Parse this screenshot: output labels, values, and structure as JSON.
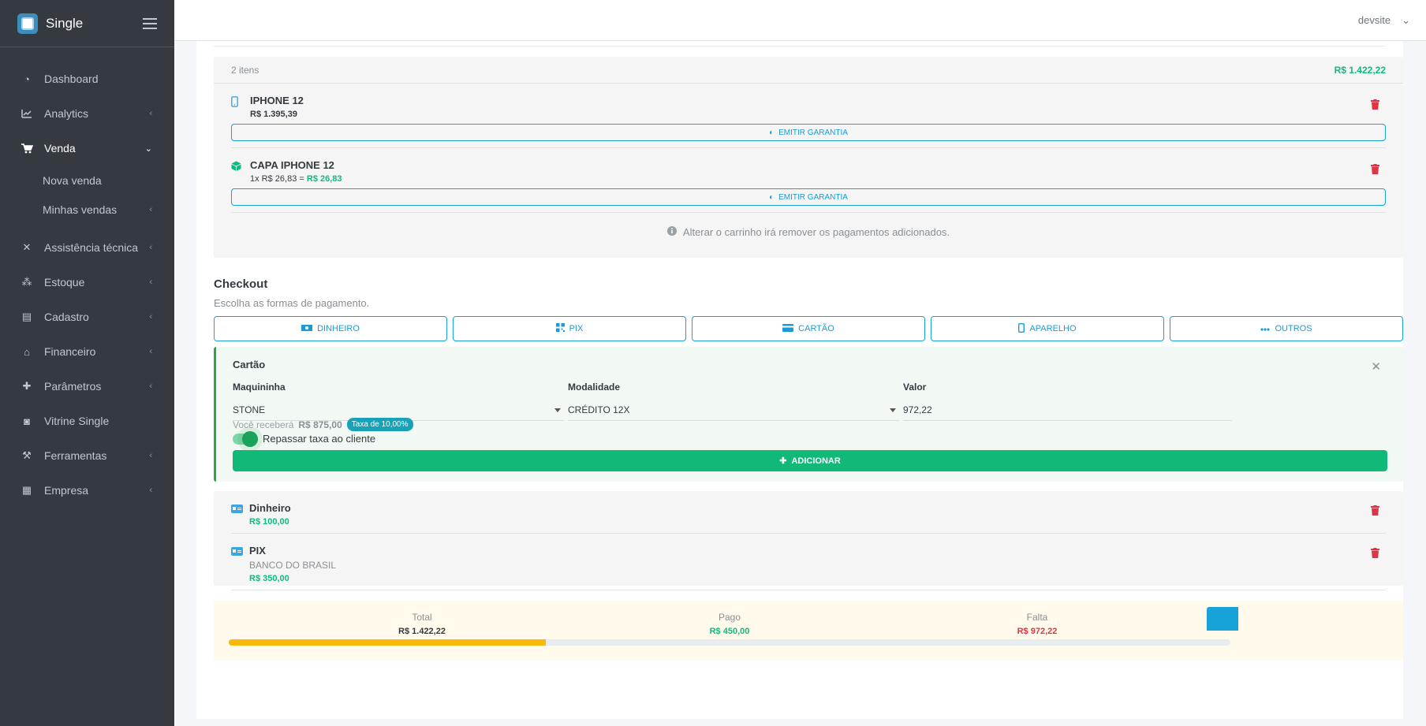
{
  "brand": {
    "name": "Single"
  },
  "sidebar": {
    "items": [
      {
        "label": "Dashboard",
        "icon": "pie-chart-icon"
      },
      {
        "label": "Analytics",
        "icon": "line-chart-icon"
      },
      {
        "label": "Venda",
        "icon": "shopping-cart-icon",
        "active": true
      },
      {
        "label": "Nova venda"
      },
      {
        "label": "Minhas vendas"
      },
      {
        "label": "Assistência técnica",
        "icon": "tools-icon"
      },
      {
        "label": "Estoque",
        "icon": "boxes-icon"
      },
      {
        "label": "Cadastro",
        "icon": "id-card-icon"
      },
      {
        "label": "Financeiro",
        "icon": "bank-icon"
      },
      {
        "label": "Parâmetros",
        "icon": "puzzle-icon"
      },
      {
        "label": "Vitrine Single",
        "icon": "shopping-bag-icon"
      },
      {
        "label": "Ferramentas",
        "icon": "wrench-icon"
      },
      {
        "label": "Empresa",
        "icon": "building-icon"
      }
    ]
  },
  "topbar": {
    "user": "devsite"
  },
  "cart": {
    "count_label": "2 itens",
    "total": "R$ 1.422,22",
    "items": [
      {
        "title": "IPHONE 12",
        "price": "R$ 1.395,39",
        "guarantee_label": "EMITIR GARANTIA"
      },
      {
        "title": "CAPA IPHONE 12",
        "qty_label": "1x R$ 26,83 =",
        "price": "R$ 26,83",
        "guarantee_label": "EMITIR GARANTIA"
      }
    ],
    "note": "Alterar o carrinho irá remover os pagamentos adicionados."
  },
  "checkout": {
    "title": "Checkout",
    "subtitle": "Escolha as formas de pagamento.",
    "methods": [
      "DINHEIRO",
      "PIX",
      "CARTÃO",
      "APARELHO",
      "OUTROS"
    ]
  },
  "card_panel": {
    "title": "Cartão",
    "maquininha_label": "Maquininha",
    "maquininha_value": "STONE",
    "modalidade_label": "Modalidade",
    "modalidade_value": "CRÉDITO 12X",
    "valor_label": "Valor",
    "valor_value": "972,22",
    "receive_prefix": "Você receberá",
    "receive_amount": "R$ 875,00",
    "tax_badge": "Taxa de 10,00%",
    "toggle_label": "Repassar taxa ao cliente",
    "add_label": "ADICIONAR"
  },
  "payments": [
    {
      "title": "Dinheiro",
      "amount": "R$ 100,00"
    },
    {
      "title": "PIX",
      "sub": "BANCO DO BRASIL",
      "amount": "R$ 350,00"
    }
  ],
  "summary": {
    "total_label": "Total",
    "total_value": "R$ 1.422,22",
    "paid_label": "Pago",
    "paid_value": "R$ 450,00",
    "missing_label": "Falta",
    "missing_value": "R$ 972,22",
    "progress_fraction": 0.3164
  },
  "colors": {
    "accent": "#17a2d8",
    "success": "#10b981",
    "danger": "#dc3545",
    "warning": "#f9b90a",
    "sidebar": "#343a40"
  }
}
